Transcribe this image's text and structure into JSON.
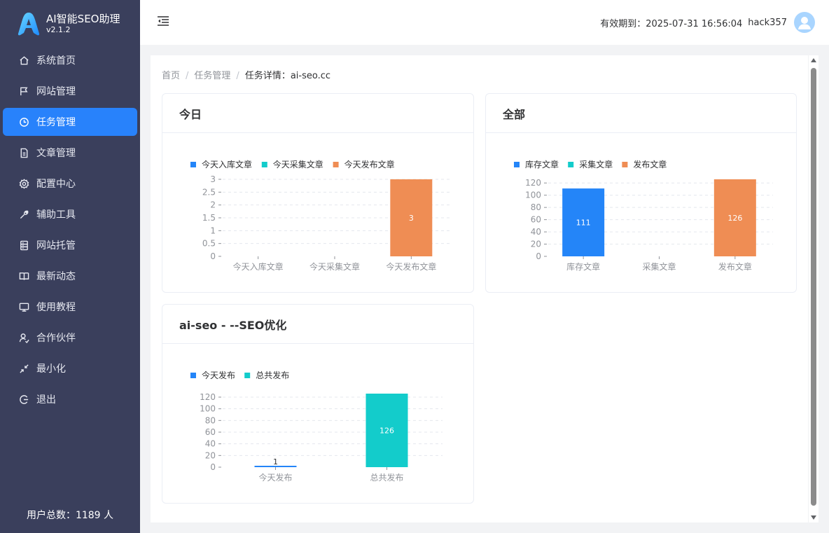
{
  "brand": {
    "name": "AI智能SEO助理",
    "version": "v2.1.2"
  },
  "sidebar": {
    "items": [
      {
        "label": "系统首页",
        "icon": "home-icon",
        "active": false
      },
      {
        "label": "网站管理",
        "icon": "flag-icon",
        "active": false
      },
      {
        "label": "任务管理",
        "icon": "clock-icon",
        "active": true
      },
      {
        "label": "文章管理",
        "icon": "document-icon",
        "active": false
      },
      {
        "label": "配置中心",
        "icon": "gear-icon",
        "active": false
      },
      {
        "label": "辅助工具",
        "icon": "wrench-icon",
        "active": false
      },
      {
        "label": "网站托管",
        "icon": "server-icon",
        "active": false
      },
      {
        "label": "最新动态",
        "icon": "book-icon",
        "active": false
      },
      {
        "label": "使用教程",
        "icon": "monitor-icon",
        "active": false
      },
      {
        "label": "合作伙伴",
        "icon": "partner-icon",
        "active": false
      },
      {
        "label": "最小化",
        "icon": "minimize-icon",
        "active": false
      },
      {
        "label": "退出",
        "icon": "logout-icon",
        "active": false
      }
    ],
    "user_total": "用户总数：1189 人"
  },
  "header": {
    "expiry_label": "有效期到：2025-07-31 16:56:04",
    "username": "hack357"
  },
  "breadcrumb": {
    "items": [
      "首页",
      "任务管理"
    ],
    "current": "任务详情：ai-seo.cc"
  },
  "cards": {
    "today_title": "今日",
    "all_title": "全部",
    "site_title": "ai-seo - --SEO优化"
  },
  "colors": {
    "blue": "#2485f8",
    "cyan": "#13cccb",
    "orange": "#ef8d54",
    "sidebar": "#3a3f5c",
    "active": "#2882fb"
  },
  "chart_data": [
    {
      "id": "today",
      "type": "bar",
      "categories": [
        "今天入库文章",
        "今天采集文章",
        "今天发布文章"
      ],
      "series": [
        {
          "name": "今天入库文章",
          "color": "#2485f8",
          "values": [
            0,
            null,
            null
          ]
        },
        {
          "name": "今天采集文章",
          "color": "#13cccb",
          "values": [
            null,
            0,
            null
          ]
        },
        {
          "name": "今天发布文章",
          "color": "#ef8d54",
          "values": [
            null,
            null,
            3
          ]
        }
      ],
      "yticks": [
        "0",
        "0.5",
        "1",
        "1.5",
        "2",
        "2.5",
        "3"
      ],
      "ylim": [
        0,
        3
      ],
      "data_labels": [
        "",
        "",
        "3"
      ],
      "legend": "top-left",
      "grid": true
    },
    {
      "id": "all",
      "type": "bar",
      "categories": [
        "库存文章",
        "采集文章",
        "发布文章"
      ],
      "series": [
        {
          "name": "库存文章",
          "color": "#2485f8",
          "values": [
            111,
            null,
            null
          ]
        },
        {
          "name": "采集文章",
          "color": "#13cccb",
          "values": [
            null,
            0,
            null
          ]
        },
        {
          "name": "发布文章",
          "color": "#ef8d54",
          "values": [
            null,
            null,
            126
          ]
        }
      ],
      "yticks": [
        "0",
        "20",
        "40",
        "60",
        "80",
        "100",
        "120"
      ],
      "ylim": [
        0,
        126
      ],
      "data_labels": [
        "111",
        "",
        "126"
      ],
      "legend": "top-left",
      "grid": true
    },
    {
      "id": "site",
      "type": "bar",
      "categories": [
        "今天发布",
        "总共发布"
      ],
      "series": [
        {
          "name": "今天发布",
          "color": "#2485f8",
          "values": [
            1,
            null
          ]
        },
        {
          "name": "总共发布",
          "color": "#13cccb",
          "values": [
            null,
            126
          ]
        }
      ],
      "yticks": [
        "0",
        "20",
        "40",
        "60",
        "80",
        "100",
        "120"
      ],
      "ylim": [
        0,
        126
      ],
      "data_labels": [
        "1",
        "126"
      ],
      "legend": "top-left",
      "grid": true
    }
  ]
}
